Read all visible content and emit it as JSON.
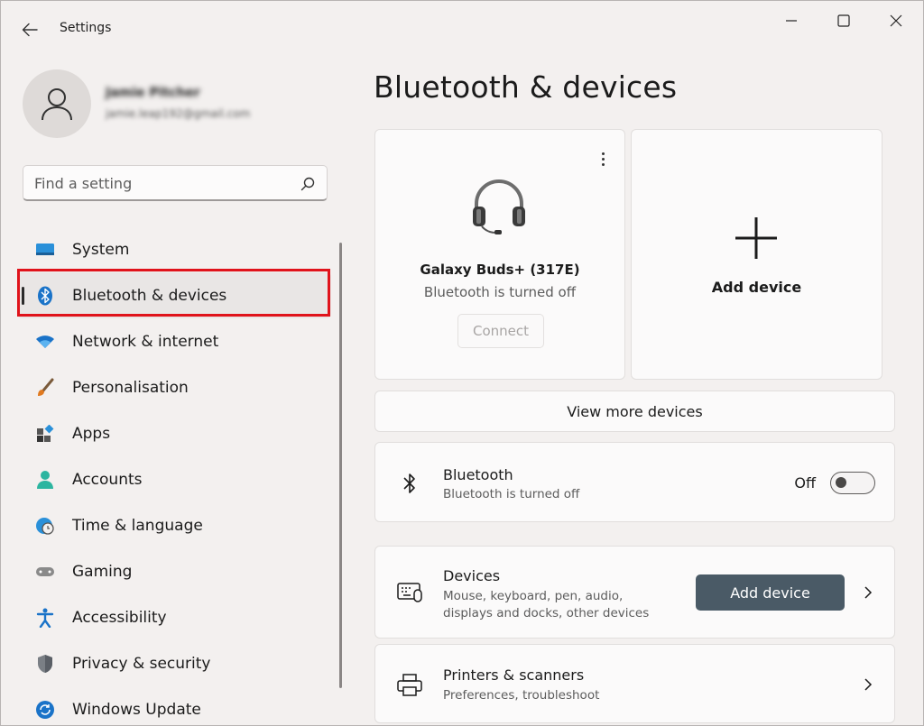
{
  "window": {
    "title": "Settings"
  },
  "profile": {
    "name": "Jamie Pitcher",
    "email": "jamie.leap192@gmail.com"
  },
  "search": {
    "placeholder": "Find a setting"
  },
  "nav": {
    "items": [
      {
        "label": "System",
        "icon": "system-icon"
      },
      {
        "label": "Bluetooth & devices",
        "icon": "bluetooth-icon",
        "active": true
      },
      {
        "label": "Network & internet",
        "icon": "wifi-icon"
      },
      {
        "label": "Personalisation",
        "icon": "brush-icon"
      },
      {
        "label": "Apps",
        "icon": "apps-icon"
      },
      {
        "label": "Accounts",
        "icon": "person-icon"
      },
      {
        "label": "Time & language",
        "icon": "globe-clock-icon"
      },
      {
        "label": "Gaming",
        "icon": "gamepad-icon"
      },
      {
        "label": "Accessibility",
        "icon": "accessibility-icon"
      },
      {
        "label": "Privacy & security",
        "icon": "shield-icon"
      },
      {
        "label": "Windows Update",
        "icon": "update-icon"
      }
    ]
  },
  "main": {
    "title": "Bluetooth & devices",
    "device_card": {
      "name": "Galaxy Buds+ (317E)",
      "status": "Bluetooth is turned off",
      "connect_label": "Connect"
    },
    "add_card": {
      "label": "Add device"
    },
    "view_more_label": "View more devices",
    "bluetooth": {
      "title": "Bluetooth",
      "subtitle": "Bluetooth is turned off",
      "toggle_label": "Off",
      "toggle_on": false
    },
    "devices": {
      "title": "Devices",
      "subtitle_line1": "Mouse, keyboard, pen, audio,",
      "subtitle_line2": "displays and docks, other devices",
      "button_label": "Add device"
    },
    "printers": {
      "title": "Printers & scanners",
      "subtitle": "Preferences, troubleshoot"
    }
  },
  "colors": {
    "accent_button": "#4a5a66",
    "highlight": "#e0131b",
    "background": "#f3f0ef"
  }
}
